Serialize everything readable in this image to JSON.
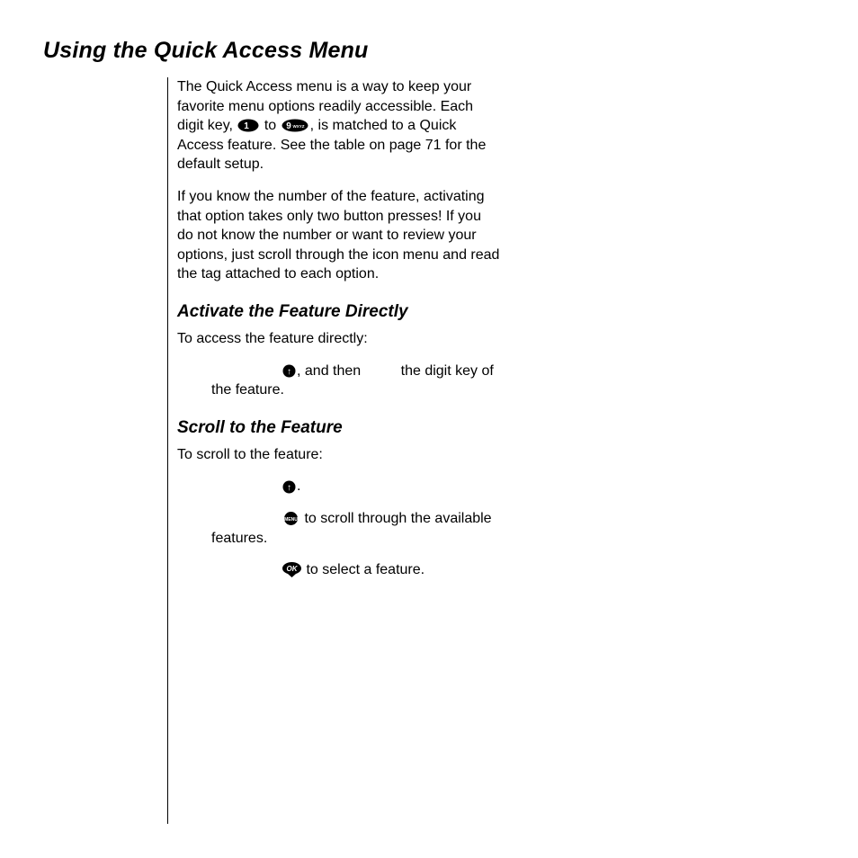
{
  "title": "Using the Quick Access Menu",
  "intro": {
    "p1_pre": "The Quick Access menu is a way to keep your favorite menu options readily accessible. Each digit key, ",
    "p1_mid": " to ",
    "p1_post": ", is matched to a Quick Access feature. See the table on page 71 for the default setup.",
    "p2": "If you know the number of the feature, activating that option takes only two button presses! If you do not know the number or want to review your options, just scroll through the icon menu and read the tag attached to each option."
  },
  "section_activate": {
    "heading": "Activate the Feature Directly",
    "lead": "To access the feature directly:",
    "step1_mid": ", and then",
    "step1_tail": "the digit key of the feature."
  },
  "section_scroll": {
    "heading": "Scroll to the Feature",
    "lead": "To scroll to the feature:",
    "step1_tail": ".",
    "step2_tail": " to scroll through the available features.",
    "step3_tail": " to select a feature."
  },
  "keys": {
    "one": "1",
    "nine": "9",
    "nine_letters": "WXYZ",
    "up": "↑",
    "menu": "MENU",
    "ok": "OK"
  }
}
